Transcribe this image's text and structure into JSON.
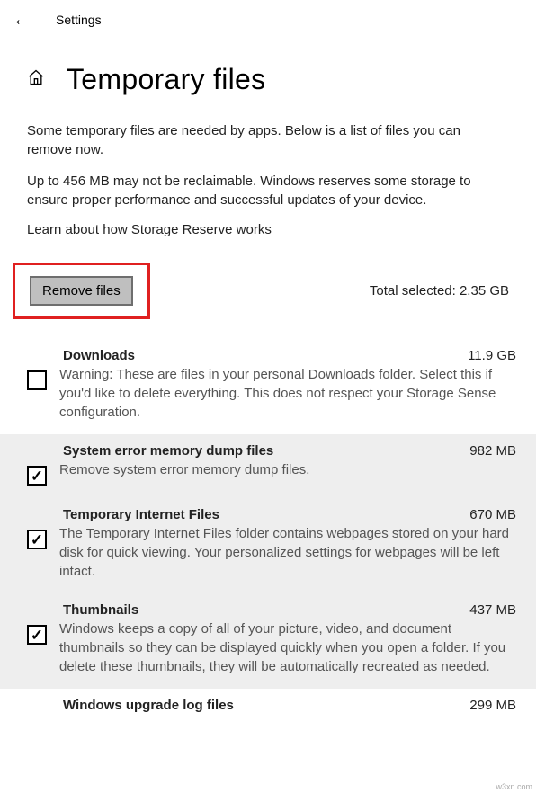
{
  "titlebar": {
    "settings": "Settings"
  },
  "header": {
    "title": "Temporary files"
  },
  "intro": {
    "p1": "Some temporary files are needed by apps. Below is a list of files you can remove now.",
    "p2": "Up to 456 MB may not be reclaimable. Windows reserves some storage to ensure proper performance and successful updates of your device.",
    "link": "Learn about how Storage Reserve works"
  },
  "action": {
    "remove_label": "Remove files",
    "total_label": "Total selected: 2.35 GB"
  },
  "items": [
    {
      "title": "Downloads",
      "size": "11.9 GB",
      "desc": "Warning: These are files in your personal Downloads folder. Select this if you'd like to delete everything. This does not respect your Storage Sense configuration.",
      "checked": false
    },
    {
      "title": "System error memory dump files",
      "size": "982 MB",
      "desc": "Remove system error memory dump files.",
      "checked": true
    },
    {
      "title": "Temporary Internet Files",
      "size": "670 MB",
      "desc": "The Temporary Internet Files folder contains webpages stored on your hard disk for quick viewing. Your personalized settings for webpages will be left intact.",
      "checked": true
    },
    {
      "title": "Thumbnails",
      "size": "437 MB",
      "desc": "Windows keeps a copy of all of your picture, video, and document thumbnails so they can be displayed quickly when you open a folder. If you delete these thumbnails, they will be automatically recreated as needed.",
      "checked": true
    },
    {
      "title": "Windows upgrade log files",
      "size": "299 MB",
      "desc": "",
      "checked": false
    }
  ]
}
